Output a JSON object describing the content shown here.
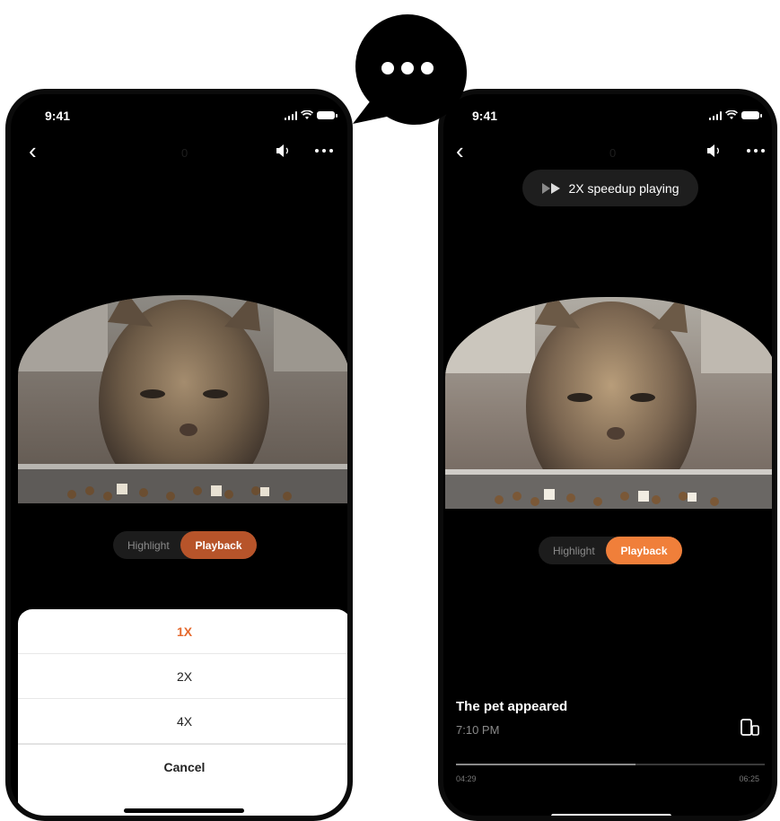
{
  "colors": {
    "accent_dim": "#b7542a",
    "accent": "#f07f3a",
    "background": "#000000"
  },
  "left_phone": {
    "time": "9:41",
    "title": "0",
    "segment": {
      "highlight": "Highlight",
      "playback": "Playback"
    },
    "sheet": {
      "options": [
        "1X",
        "2X",
        "4X"
      ],
      "selected": "1X",
      "cancel": "Cancel"
    }
  },
  "right_phone": {
    "time": "9:41",
    "title": "0",
    "toast": "2X speedup playing",
    "segment": {
      "highlight": "Highlight",
      "playback": "Playback"
    },
    "event": {
      "title": "The pet appeared",
      "time": "7:10 PM"
    },
    "progress": {
      "elapsed": "04:29",
      "total": "06:25",
      "fraction": 0.58
    }
  },
  "callout": {
    "icon": "more-dots-icon"
  }
}
